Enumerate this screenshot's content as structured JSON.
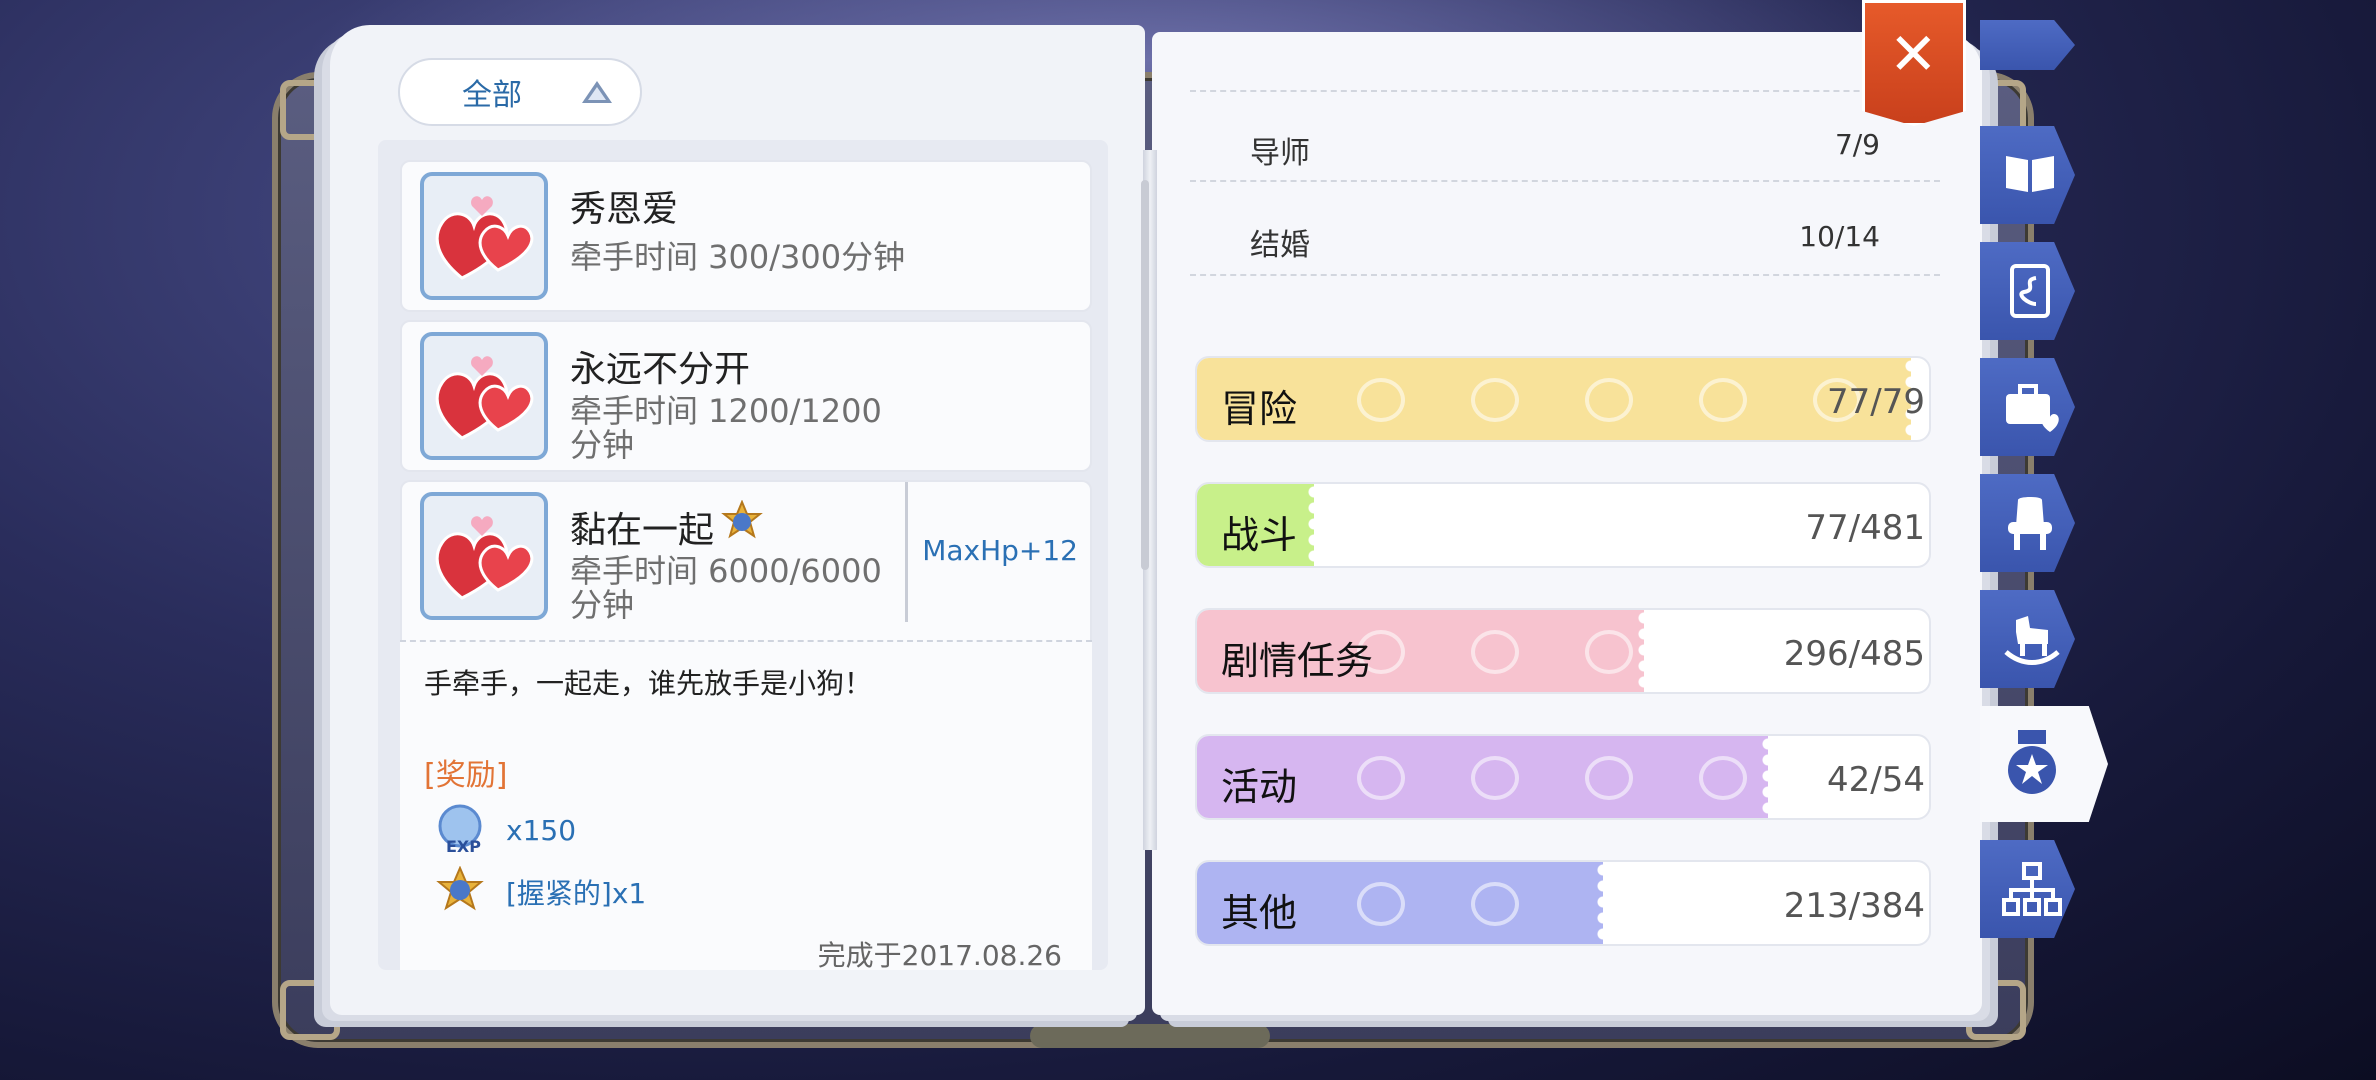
{
  "filter": {
    "label": "全部"
  },
  "achievements": [
    {
      "title": "秀恩爱",
      "desc": "牵手时间 300/300分钟"
    },
    {
      "title": "永远不分开",
      "desc": "牵手时间 1200/1200分钟"
    },
    {
      "title": "黏在一起",
      "desc": "牵手时间 6000/6000分钟",
      "reward": "MaxHp+12"
    }
  ],
  "detail": {
    "flavor": "手牵手，一起走，谁先放手是小狗！",
    "reward_label": "[奖励]",
    "exp": "x150",
    "item": "[握紧的]x1",
    "completed": "完成于2017.08.26"
  },
  "right_rows": [
    {
      "name": "导师",
      "value": "7/9"
    },
    {
      "name": "结婚",
      "value": "10/14"
    }
  ],
  "categories": [
    {
      "name": "冒险",
      "count": "77/79",
      "progress": 0.975,
      "color": "#f8e29a"
    },
    {
      "name": "战斗",
      "count": "77/481",
      "progress": 0.16,
      "color": "#c8f08a"
    },
    {
      "name": "剧情任务",
      "count": "296/485",
      "progress": 0.61,
      "color": "#f7c3cf"
    },
    {
      "name": "活动",
      "count": "42/54",
      "progress": 0.78,
      "color": "#d6b6f0"
    },
    {
      "name": "其他",
      "count": "213/384",
      "progress": 0.555,
      "color": "#aeb4f2"
    }
  ],
  "tabs": [
    "book-icon",
    "card-icon",
    "briefcase-heart-icon",
    "chair-icon",
    "rocking-horse-icon",
    "medal-icon",
    "hierarchy-icon"
  ],
  "active_tab": "medal-icon"
}
